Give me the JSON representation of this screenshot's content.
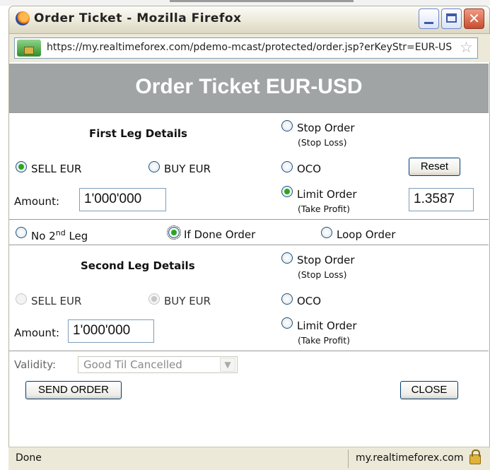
{
  "window": {
    "title": "Order Ticket - Mozilla Firefox",
    "url": "https://my.realtimeforex.com/pdemo-mcast/protected/order.jsp?erKeyStr=EUR-US"
  },
  "page": {
    "title": "Order Ticket EUR-USD"
  },
  "first_leg": {
    "heading": "First Leg Details",
    "sell_label": "SELL EUR",
    "buy_label": "BUY EUR",
    "amount_label": "Amount:",
    "amount_value": "1'000'000",
    "stop_order_label": "Stop Order",
    "stop_order_sub": "(Stop Loss)",
    "oco_label": "OCO",
    "limit_order_label": "Limit Order",
    "limit_order_sub": "(Take Profit)",
    "reset_label": "Reset",
    "price_value": "1.3587",
    "selected_side": "SELL EUR",
    "selected_order_type": "Limit Order"
  },
  "leg_options": {
    "no_second_leg_prefix": "No 2",
    "no_second_leg_sup": "nd",
    "no_second_leg_suffix": " Leg",
    "if_done_label": "If Done Order",
    "loop_label": "Loop Order",
    "selected": "If Done Order"
  },
  "second_leg": {
    "heading": "Second Leg Details",
    "sell_label": "SELL EUR",
    "buy_label": "BUY EUR",
    "amount_label": "Amount:",
    "amount_value": "1'000'000",
    "stop_order_label": "Stop Order",
    "stop_order_sub": "(Stop Loss)",
    "oco_label": "OCO",
    "limit_order_label": "Limit Order",
    "limit_order_sub": "(Take Profit)",
    "selected_side": "BUY EUR"
  },
  "footer": {
    "validity_label": "Validity:",
    "validity_value": "Good Til Cancelled",
    "send_label": "SEND ORDER",
    "close_label": "CLOSE"
  },
  "statusbar": {
    "left": "Done",
    "right": "my.realtimeforex.com"
  }
}
